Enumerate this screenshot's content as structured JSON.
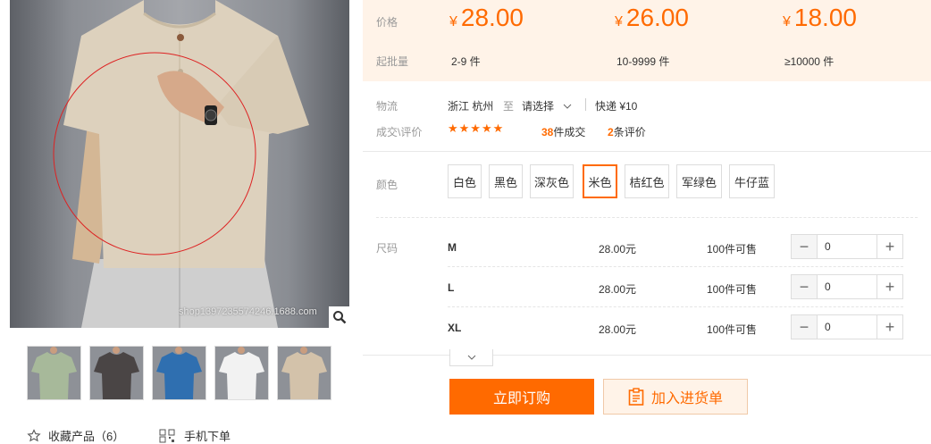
{
  "gallery": {
    "watermark": "shop1397235574246.1688.com",
    "thumbnails": [
      {
        "shirt_color": "#a7b99a"
      },
      {
        "shirt_color": "#4a4545"
      },
      {
        "shirt_color": "#2f6fb0"
      },
      {
        "shirt_color": "#f2f2f2"
      },
      {
        "shirt_color": "#d3c2aa"
      }
    ],
    "favorite_label": "收藏产品（6）",
    "mobile_order_label": "手机下单"
  },
  "pricing": {
    "price_label": "价格",
    "moq_label": "起批量",
    "currency": "¥",
    "tiers": [
      {
        "price": "28.00",
        "range": "2-9 件"
      },
      {
        "price": "26.00",
        "range": "10-9999 件"
      },
      {
        "price": "18.00",
        "range": "≥10000 件"
      }
    ]
  },
  "logistics": {
    "label": "物流",
    "origin": "浙江 杭州",
    "to": "至",
    "destination": "请选择",
    "shipping": "快递 ¥10"
  },
  "reviews": {
    "label": "成交\\评价",
    "stars": "★★★★★",
    "deals_count": "38",
    "deals_label": "件成交",
    "reviews_count": "2",
    "reviews_label": "条评价"
  },
  "colors": {
    "label": "颜色",
    "options": [
      "白色",
      "黑色",
      "深灰色",
      "米色",
      "桔红色",
      "军绿色",
      "牛仔蓝"
    ],
    "selected": "米色"
  },
  "sizes": {
    "label": "尺码",
    "rows": [
      {
        "size": "M",
        "price": "28.00元",
        "stock": "100件可售",
        "qty": "0"
      },
      {
        "size": "L",
        "price": "28.00元",
        "stock": "100件可售",
        "qty": "0"
      },
      {
        "size": "XL",
        "price": "28.00元",
        "stock": "100件可售",
        "qty": "0"
      }
    ]
  },
  "actions": {
    "buy_now": "立即订购",
    "add_to_list": "加入进货单"
  },
  "theme": {
    "accent": "#ff6a00",
    "band": "#fff3e8"
  }
}
